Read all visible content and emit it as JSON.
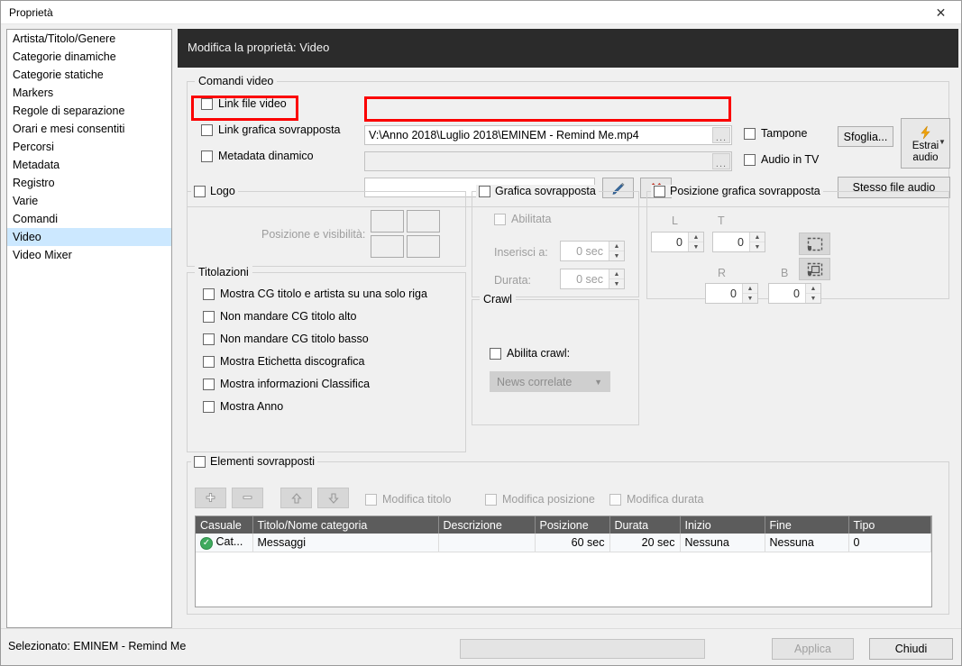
{
  "window": {
    "title": "Proprietà",
    "close_icon": "close-icon"
  },
  "sidebar": {
    "items": [
      {
        "label": "Artista/Titolo/Genere",
        "selected": false
      },
      {
        "label": "Categorie dinamiche",
        "selected": false
      },
      {
        "label": "Categorie statiche",
        "selected": false
      },
      {
        "label": "Markers",
        "selected": false
      },
      {
        "label": "Regole di separazione",
        "selected": false
      },
      {
        "label": "Orari e mesi consentiti",
        "selected": false
      },
      {
        "label": "Percorsi",
        "selected": false
      },
      {
        "label": "Metadata",
        "selected": false
      },
      {
        "label": "Registro",
        "selected": false
      },
      {
        "label": "Varie",
        "selected": false
      },
      {
        "label": "Comandi",
        "selected": false
      },
      {
        "label": "Video",
        "selected": true
      },
      {
        "label": "Video Mixer",
        "selected": false
      }
    ]
  },
  "header": {
    "title": "Modifica la proprietà: Video"
  },
  "video_commands": {
    "group_label": "Comandi video",
    "link_video_file": {
      "label": "Link file video",
      "checked": false
    },
    "link_overlay_graphic": {
      "label": "Link grafica sovrapposta",
      "checked": false
    },
    "dynamic_metadata": {
      "label": "Metadata dinamico",
      "checked": false
    },
    "video_path_value": "V:\\Anno 2018\\Luglio 2018\\EMINEM - Remind Me.mp4",
    "overlay_path_value": "",
    "metadata_value": "",
    "browse_dots": "...",
    "tampone": {
      "label": "Tampone",
      "checked": false
    },
    "audio_in_tv": {
      "label": "Audio in TV",
      "checked": false
    },
    "browse_button": "Sfoglia...",
    "extract_audio_button": "Estrai audio",
    "extract_audio_icon": "lightning-bolt-icon",
    "extract_audio_dropdown_icon": "chevron-down-icon",
    "same_audio_file_button": "Stesso file audio",
    "edit_icon": "pencil-icon",
    "delete_icon": "red-x-icon"
  },
  "logo": {
    "group_label": "Logo",
    "checked": false,
    "position_label": "Posizione e visibilità:",
    "cells": [
      "logo-pos-top-left",
      "logo-pos-top-right",
      "logo-pos-bottom-left",
      "logo-pos-bottom-right"
    ]
  },
  "titolazioni": {
    "group_label": "Titolazioni",
    "items": [
      {
        "label": "Mostra CG titolo e artista su una solo riga",
        "checked": false
      },
      {
        "label": "Non mandare CG titolo alto",
        "checked": false
      },
      {
        "label": "Non mandare CG titolo basso",
        "checked": false
      },
      {
        "label": "Mostra Etichetta discografica",
        "checked": false
      },
      {
        "label": "Mostra informazioni Classifica",
        "checked": false
      },
      {
        "label": "Mostra Anno",
        "checked": false
      }
    ]
  },
  "overlay_graphic": {
    "group_label": "Grafica sovrapposta",
    "checked": false,
    "enabled_label": "Abilitata",
    "enabled_checked": false,
    "insert_at_label": "Inserisci a:",
    "insert_at_value": "0 sec",
    "duration_label": "Durata:",
    "duration_value": "0 sec"
  },
  "crawl": {
    "group_label": "Crawl",
    "enable_label": "Abilita crawl:",
    "enable_checked": false,
    "dropdown_value": "News correlate",
    "dropdown_icon": "chevron-down-icon"
  },
  "overlay_position": {
    "group_label": "Posizione grafica sovrapposta",
    "checked": false,
    "left_label": "L",
    "left_value": "0",
    "top_label": "T",
    "top_value": "0",
    "right_label": "R",
    "right_value": "0",
    "bottom_label": "B",
    "bottom_value": "0",
    "icon_fullframe": "select-region-icon",
    "icon_fitimage": "fit-image-region-icon"
  },
  "overlay_items": {
    "group_label": "Elementi sovrapposti",
    "checked": false,
    "add_icon": "plus-icon",
    "remove_icon": "minus-icon",
    "up_icon": "arrow-up-icon",
    "down_icon": "arrow-down-icon",
    "edit_title": {
      "label": "Modifica titolo",
      "checked": false
    },
    "edit_position": {
      "label": "Modifica posizione",
      "checked": false
    },
    "edit_duration": {
      "label": "Modifica durata",
      "checked": false
    },
    "columns": [
      "Casuale",
      "Titolo/Nome categoria",
      "Descrizione",
      "Posizione",
      "Durata",
      "Inizio",
      "Fine",
      "Tipo"
    ],
    "rows": [
      {
        "status_icon": "green-check-icon",
        "casuale": "Cat...",
        "titolo": "Messaggi",
        "descrizione": "",
        "posizione": "60 sec",
        "durata": "20 sec",
        "inizio": "Nessuna",
        "fine": "Nessuna",
        "tipo": "0"
      }
    ]
  },
  "footer": {
    "status": "Selezionato: EMINEM - Remind Me",
    "apply_button": "Applica",
    "close_button": "Chiudi"
  },
  "colors": {
    "highlight_red": "#fb0000",
    "selection_blue": "#cce8ff",
    "header_dark": "#2b2b2b",
    "grid_header": "#5c5c5c"
  }
}
